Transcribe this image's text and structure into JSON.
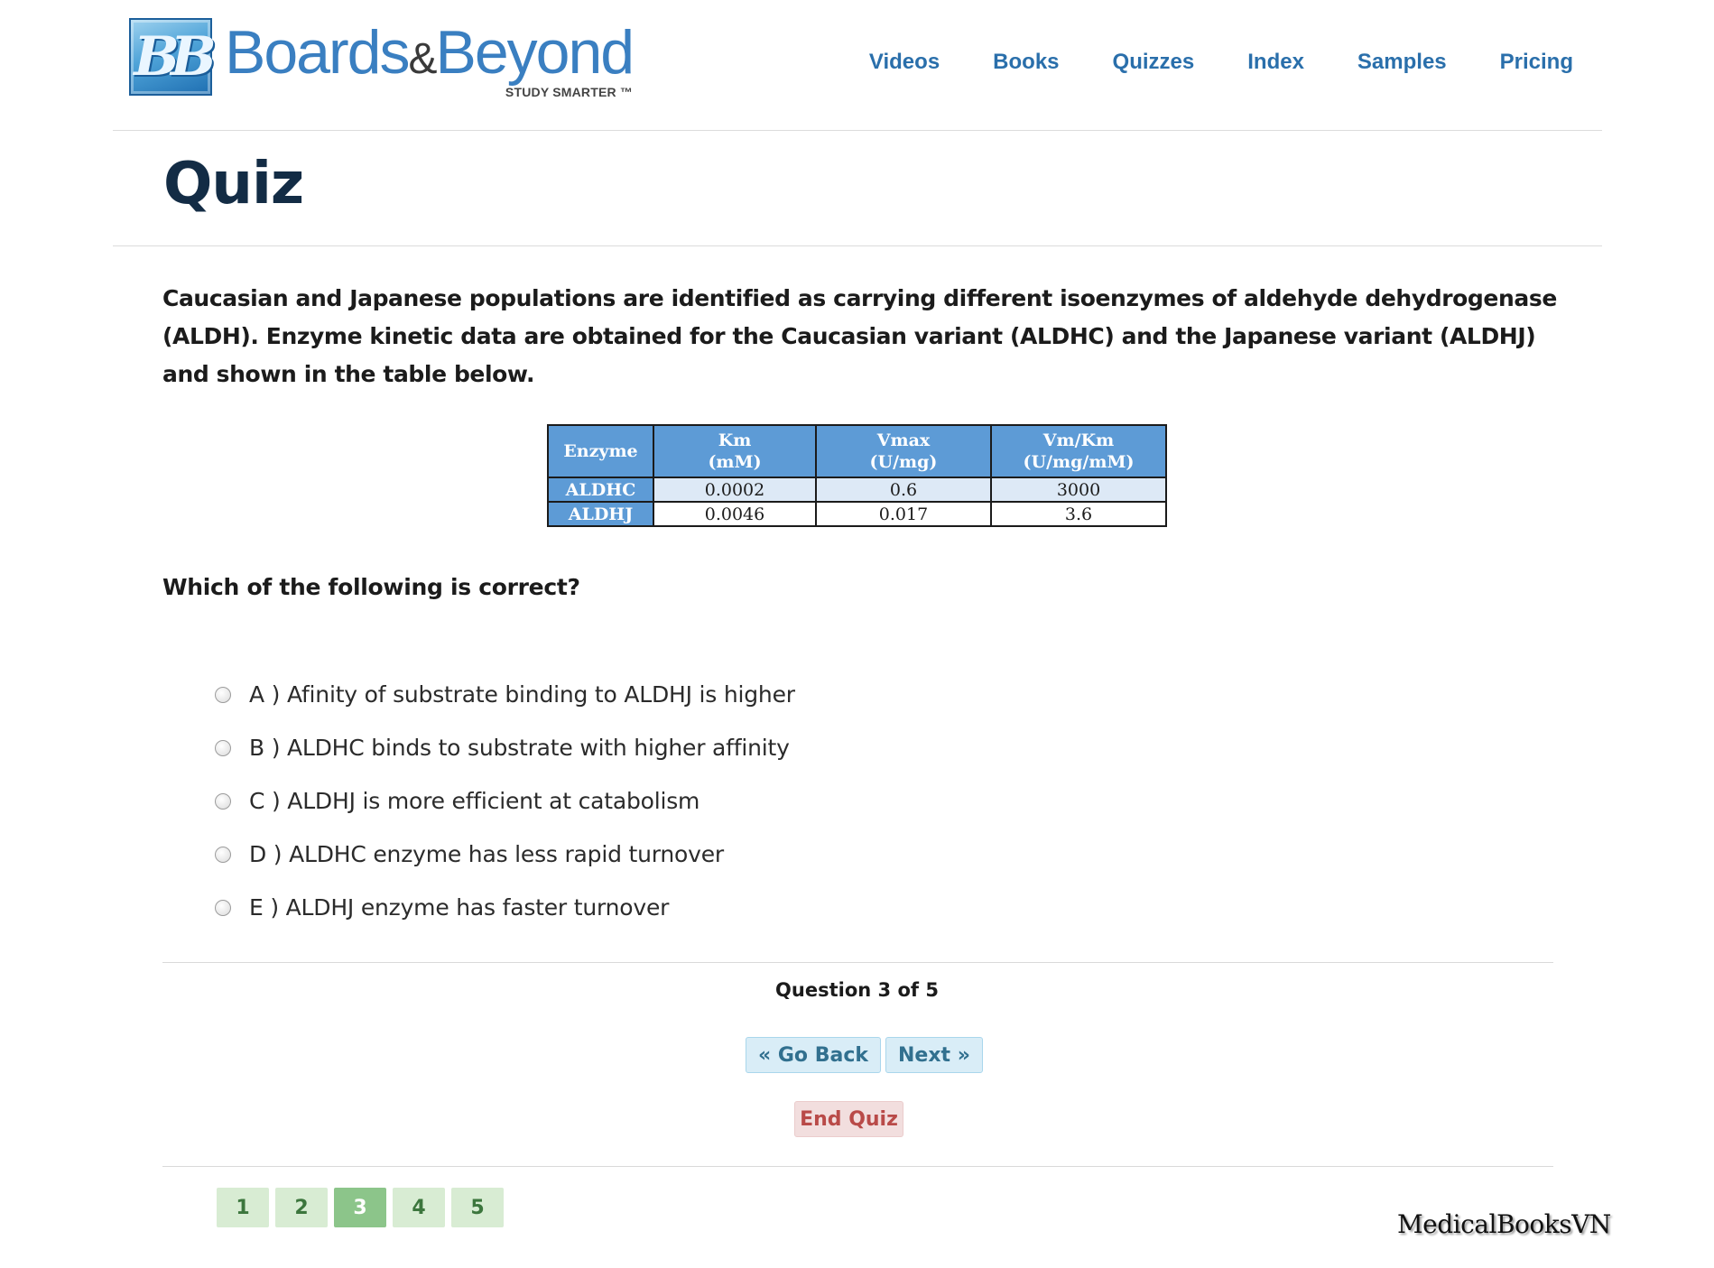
{
  "header": {
    "logo_name_a": "Boards",
    "logo_amp": "&",
    "logo_name_b": "Beyond",
    "logo_tagline": "STUDY SMARTER ™",
    "nav": [
      "Videos",
      "Books",
      "Quizzes",
      "Index",
      "Samples",
      "Pricing"
    ]
  },
  "page_title": "Quiz",
  "question": {
    "stem": "Caucasian and Japanese populations are identified as carrying different isoenzymes of aldehyde dehydrogenase (ALDH). Enzyme kinetic data are obtained for the Caucasian variant (ALDHC) and the Japanese variant (ALDHJ) and shown in the table below.",
    "table": {
      "headers": [
        "Enzyme",
        "Km",
        "(mM)",
        "Vmax",
        "(U/mg)",
        "Vm/Km",
        "(U/mg/mM)"
      ],
      "rows": [
        [
          "ALDHC",
          "0.0002",
          "0.6",
          "3000"
        ],
        [
          "ALDHJ",
          "0.0046",
          "0.017",
          "3.6"
        ]
      ]
    },
    "prompt": "Which of the following is correct?",
    "options": [
      "A ) Afinity of substrate binding to ALDHJ is higher",
      "B ) ALDHC binds to substrate with higher affinity",
      "C ) ALDHJ is more efficient at catabolism",
      "D ) ALDHC enzyme has less rapid turnover",
      "E ) ALDHJ enzyme has faster turnover"
    ]
  },
  "pager": {
    "counter": "Question 3 of 5",
    "back_label": "« Go Back",
    "next_label": "Next »",
    "end_label": "End Quiz",
    "numbers": [
      "1",
      "2",
      "3",
      "4",
      "5"
    ],
    "current": 3
  },
  "watermark": "MedicalBooksVN",
  "colors": {
    "brand_blue": "#2a6fab",
    "title_navy": "#132c45",
    "table_header": "#5d9bd6",
    "btn_info_bg": "#d9edf7",
    "btn_danger_bg": "#f2dede",
    "pager_green": "#d8ecd3",
    "pager_active": "#8cc58a"
  }
}
